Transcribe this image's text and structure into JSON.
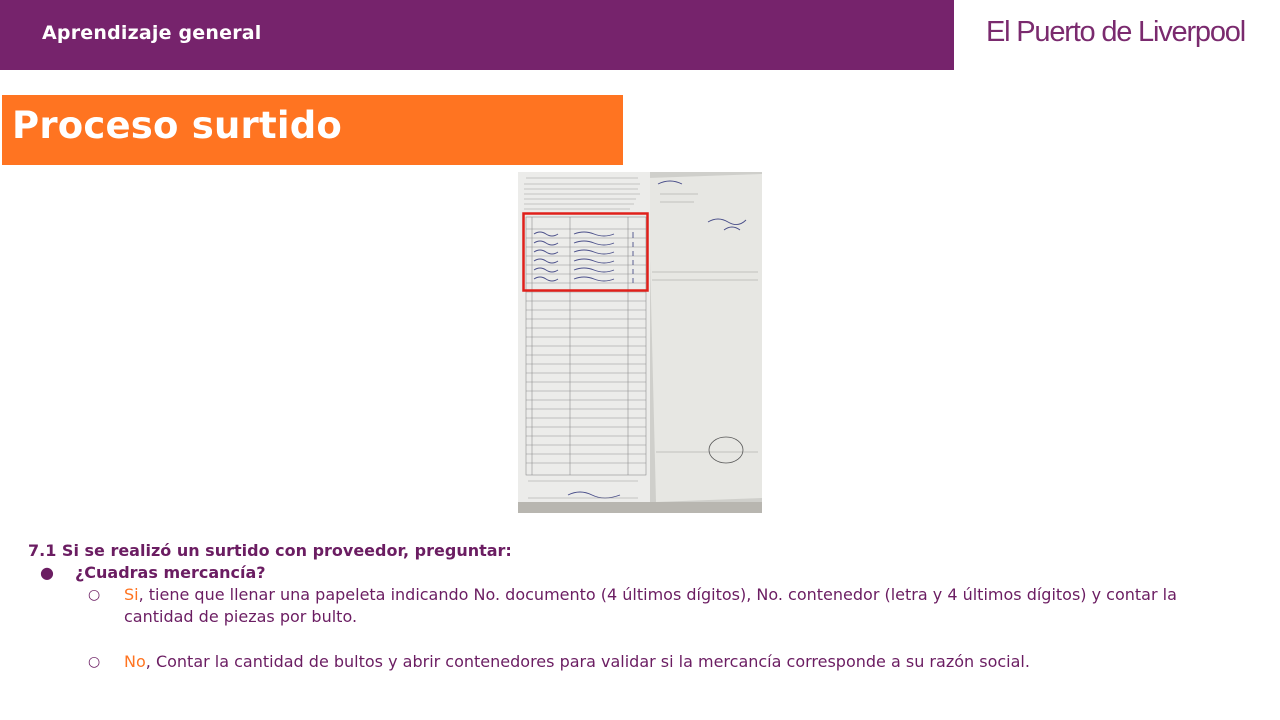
{
  "header": {
    "section_title": "Aprendizaje general",
    "brand_logo_text": "El Puerto de Liverpool"
  },
  "slide": {
    "title": "Proceso surtido"
  },
  "photo": {
    "icon": "document-photo",
    "highlight_color": "#e0201b"
  },
  "content": {
    "heading": "7.1 Si se realizó un surtido con proveedor, preguntar:",
    "bullet_symbol": "●",
    "question": "¿Cuadras mercancía?",
    "sub_symbol": "○",
    "option_yes": {
      "keyword": "Si",
      "text": ", tiene que llenar una papeleta indicando No. documento (4 últimos dígitos), No. contenedor (letra y 4 últimos dígitos) y contar la cantidad de piezas por bulto."
    },
    "option_no": {
      "keyword": "No",
      "text": ", Contar la cantidad de bultos y abrir contenedores para validar si la mercancía corresponde a su razón social."
    }
  },
  "colors": {
    "purple": "#76236c",
    "orange": "#ff7421",
    "text_purple": "#6b1d62"
  }
}
